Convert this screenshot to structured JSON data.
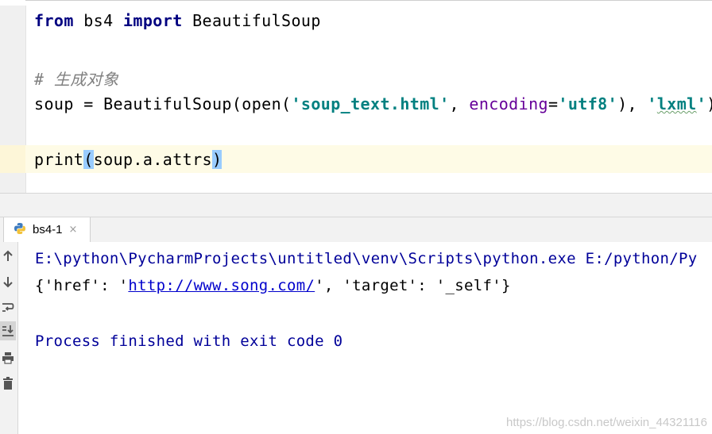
{
  "editor": {
    "line1": {
      "kw1": "from",
      "mod": " bs4 ",
      "kw2": "import",
      "name": " BeautifulSoup"
    },
    "comment": "# 生成对象",
    "line3": {
      "a": "soup = BeautifulSoup(open(",
      "s1": "'soup_text.html'",
      "b": ", ",
      "param": "encoding",
      "c": "=",
      "s2": "'utf8'",
      "d": "), ",
      "s3q": "'",
      "s3": "lxml",
      "s3q2": "'",
      "e": ")"
    },
    "line4": {
      "a": "print",
      "p1": "(",
      "b": "soup.a.attrs",
      "p2": ")"
    }
  },
  "run": {
    "tab_label": "bs4-1",
    "tab_close": "×",
    "console": {
      "cmd": "E:\\python\\PycharmProjects\\untitled\\venv\\Scripts\\python.exe E:/python/Py",
      "out_a": "{'href': '",
      "out_link": "http://www.song.com/",
      "out_b": "', 'target': '_self'}",
      "finish": "Process finished with exit code 0"
    },
    "toolbar_icons": [
      "up-arrow-icon",
      "down-arrow-icon",
      "soft-wrap-icon",
      "scroll-to-end-icon",
      "print-icon",
      "trash-icon"
    ]
  },
  "watermark": "https://blog.csdn.net/weixin_44321116"
}
